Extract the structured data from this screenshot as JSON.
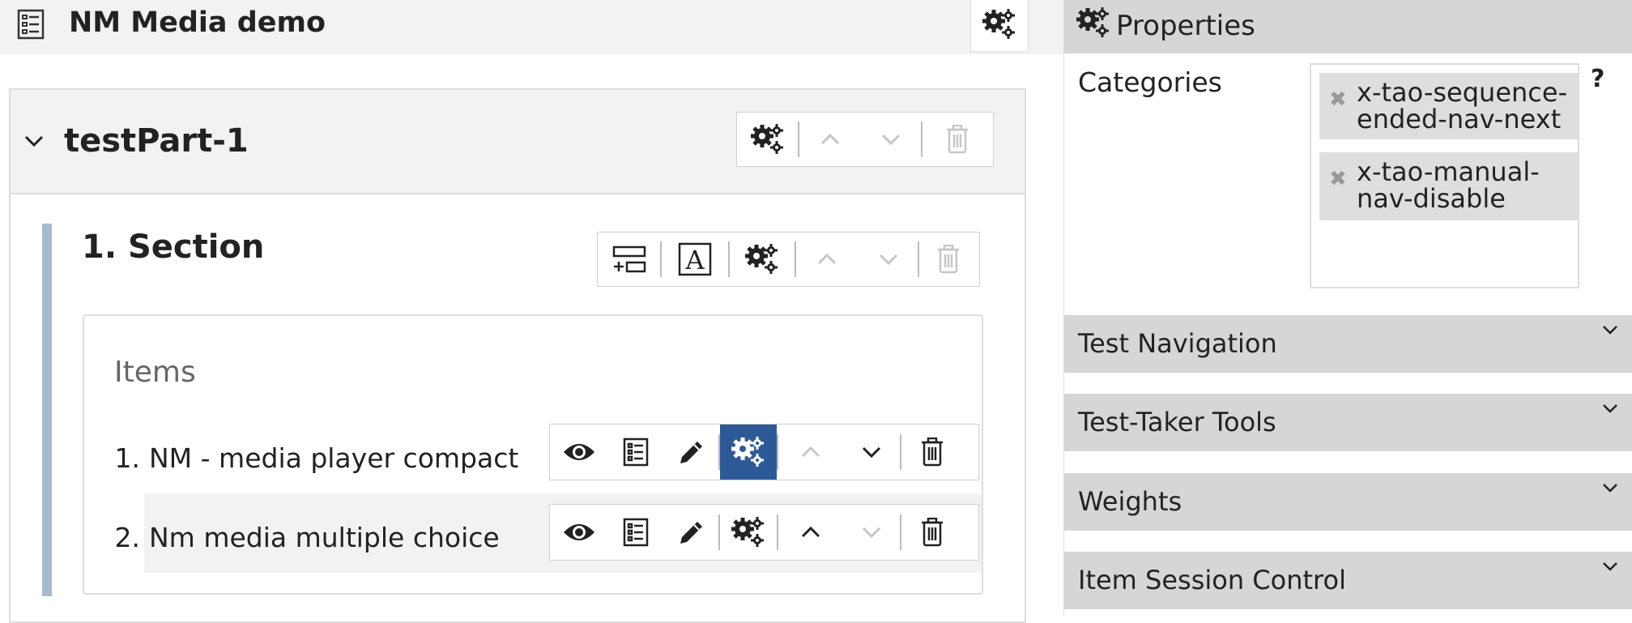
{
  "header": {
    "title": "NM Media demo",
    "doc_icon": "test-document-icon",
    "settings_icon": "gears-icon"
  },
  "test_part": {
    "title": "testPart-1",
    "actions": [
      "gears-icon",
      "move-up-icon",
      "move-down-icon",
      "trash-icon"
    ]
  },
  "section": {
    "title": "1. Section",
    "actions": [
      "add-subsection-icon",
      "rubric-block-icon",
      "gears-icon",
      "move-up-icon",
      "move-down-icon",
      "trash-icon"
    ],
    "items_heading": "Items",
    "items": [
      {
        "number": "1.",
        "label": "NM - media player compact",
        "settings_active": true
      },
      {
        "number": "2.",
        "label": "Nm media multiple choice",
        "settings_active": false
      }
    ]
  },
  "properties": {
    "title": "Properties",
    "categories_label": "Categories",
    "help_label": "?",
    "categories": [
      "x-tao-sequence-ended-nav-next",
      "x-tao-manual-nav-disable"
    ],
    "panels": [
      "Test Navigation",
      "Test-Taker Tools",
      "Weights",
      "Item Session Control"
    ]
  },
  "colors": {
    "accent": "#2d5a96",
    "section_bar": "#a7bccb",
    "panel_bg": "#d6d6d6",
    "header_bg": "#f2f2f2"
  }
}
